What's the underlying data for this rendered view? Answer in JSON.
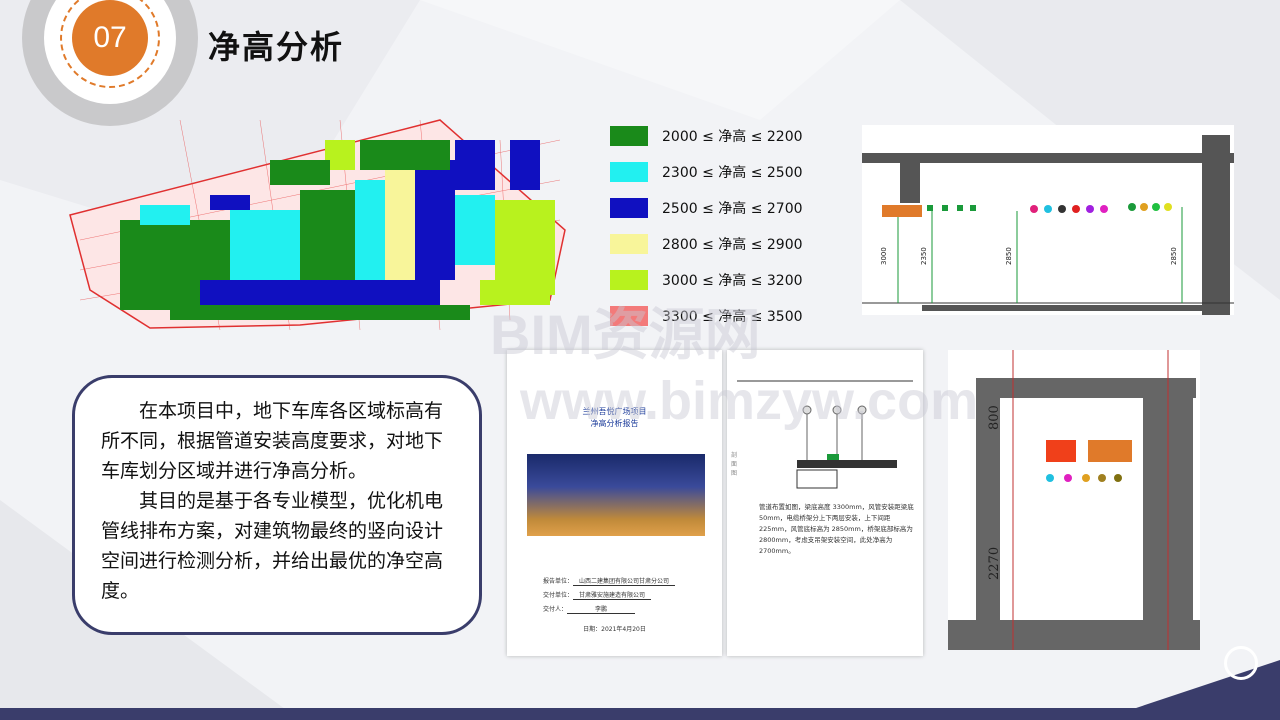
{
  "header": {
    "badge": "07",
    "title": "净高分析"
  },
  "legend": [
    {
      "label": "2000 ≤ 净高 ≤ 2200",
      "color": "#1a8a1a"
    },
    {
      "label": "2300 ≤ 净高 ≤ 2500",
      "color": "#22f0f0"
    },
    {
      "label": "2500 ≤ 净高 ≤ 2700",
      "color": "#1010c0"
    },
    {
      "label": "2800 ≤ 净高 ≤ 2900",
      "color": "#f8f59a"
    },
    {
      "label": "3000 ≤ 净高 ≤ 3200",
      "color": "#b8f21e"
    },
    {
      "label": "3300 ≤ 净高 ≤ 3500",
      "color": "#f37a7a"
    }
  ],
  "body": {
    "para1": "在本项目中，地下车库各区域标高有所不同，根据管道安装高度要求，对地下车库划分区域并进行净高分析。",
    "para2": "其目的是基于各专业模型，优化机电管线排布方案，对建筑物最终的竖向设计空间进行检测分析，并给出最优的净空高度。"
  },
  "report": {
    "title1": "兰州吾悦广场项目",
    "title2": "净高分析报告",
    "f1_label": "报告单位：",
    "f1_value": "山西二建集团有限公司甘肃分公司",
    "f2_label": "交付单位：",
    "f2_value": "甘肃雅安施建造有限公司",
    "f3_label": "交付人：",
    "f3_value": "李鹏",
    "date": "日期：2021年4月20日"
  },
  "detail": {
    "desc": "管道布置如图，梁底高度 3300mm，风管安装距梁底50mm，电缆桥架分上下两层安装，上下间距 225mm，风管底标高为 2850mm，桥架底部标高为 2800mm，考虑支吊架安装空间，此处净高为 2700mm。",
    "side_label": "剖面图"
  },
  "section1": {
    "dim1": "3000",
    "dim2": "2350",
    "dim3": "2850",
    "dim4": "2850"
  },
  "section2": {
    "dim_top": "800",
    "dim_bottom": "2270"
  },
  "watermark": {
    "line1": "BIM资源网",
    "line2": "www.bimzyw.com"
  }
}
